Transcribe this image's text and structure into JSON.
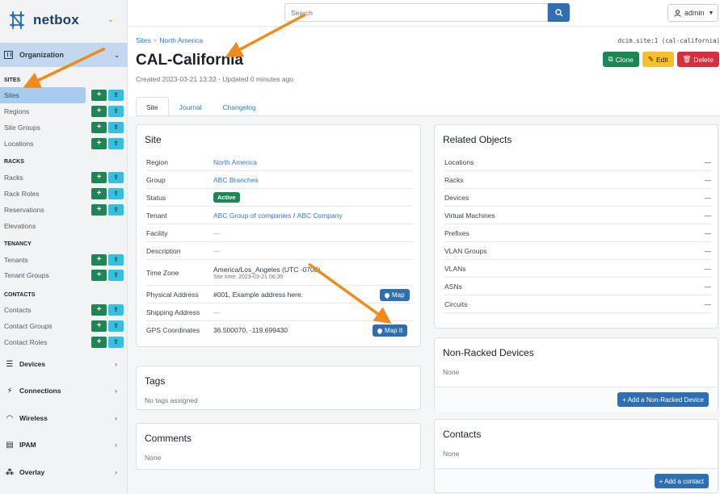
{
  "brand": {
    "name": "netbox"
  },
  "sidebar": {
    "organization": {
      "label": "Organization"
    },
    "sections": {
      "sites": "SITES",
      "racks": "RACKS",
      "tenancy": "TENANCY",
      "contacts": "CONTACTS"
    },
    "items": {
      "sites": "Sites",
      "regions": "Regions",
      "site_groups": "Site Groups",
      "locations": "Locations",
      "racks": "Racks",
      "rack_roles": "Rack Roles",
      "reservations": "Reservations",
      "elevations": "Elevations",
      "tenants": "Tenants",
      "tenant_groups": "Tenant Groups",
      "contacts": "Contacts",
      "contact_groups": "Contact Groups",
      "contact_roles": "Contact Roles"
    },
    "groups": {
      "devices": "Devices",
      "connections": "Connections",
      "wireless": "Wireless",
      "ipam": "IPAM",
      "overlay": "Overlay"
    },
    "add_glyph": "+",
    "import_glyph": "⇪"
  },
  "topbar": {
    "search_placeholder": "Search",
    "user": "admin"
  },
  "page": {
    "breadcrumb": {
      "root": "Sites",
      "parent": "North America"
    },
    "slug": "dcim.site:1 (cal-california)",
    "title": "CAL-California",
    "created": "Created 2023-03-21 13:32 · Updated 0 minutes ago",
    "actions": {
      "clone": "Clone",
      "edit": "Edit",
      "delete": "Delete"
    },
    "tabs": {
      "site": "Site",
      "journal": "Journal",
      "changelog": "Changelog"
    }
  },
  "site_card": {
    "title": "Site",
    "rows": {
      "region": {
        "label": "Region",
        "value": "North America"
      },
      "group": {
        "label": "Group",
        "value": "ABC Branches"
      },
      "status": {
        "label": "Status",
        "value": "Active"
      },
      "tenant": {
        "label": "Tenant",
        "value_group": "ABC Group of companies",
        "sep": " / ",
        "value": "ABC Company"
      },
      "facility": {
        "label": "Facility",
        "value": "—"
      },
      "description": {
        "label": "Description",
        "value": "—"
      },
      "time_zone": {
        "label": "Time Zone",
        "value": "America/Los_Angeles (UTC -0700)",
        "sub": "Site time: 2023-03-21 06:35"
      },
      "physical_address": {
        "label": "Physical Address",
        "value": "#001, Example address here.",
        "button": "Map"
      },
      "shipping_address": {
        "label": "Shipping Address",
        "value": "—"
      },
      "gps": {
        "label": "GPS Coordinates",
        "value": "36.500070, -119.699430",
        "button": "Map It"
      }
    }
  },
  "tags_card": {
    "title": "Tags",
    "empty": "No tags assigned"
  },
  "comments_card": {
    "title": "Comments",
    "empty": "None"
  },
  "related_card": {
    "title": "Related Objects",
    "rows": [
      {
        "label": "Locations",
        "value": "—"
      },
      {
        "label": "Racks",
        "value": "—"
      },
      {
        "label": "Devices",
        "value": "—"
      },
      {
        "label": "Virtual Machines",
        "value": "—"
      },
      {
        "label": "Prefixes",
        "value": "—"
      },
      {
        "label": "VLAN Groups",
        "value": "—"
      },
      {
        "label": "VLANs",
        "value": "—"
      },
      {
        "label": "ASNs",
        "value": "—"
      },
      {
        "label": "Circuits",
        "value": "—"
      }
    ]
  },
  "non_racked_card": {
    "title": "Non-Racked Devices",
    "empty": "None",
    "button": "+ Add a Non-Racked Device"
  },
  "contacts_card": {
    "title": "Contacts",
    "empty": "None",
    "button": "+ Add a contact"
  },
  "colors": {
    "accent": "#2f7bd1",
    "success": "#1a8754",
    "warning": "#f6c02a",
    "danger": "#d32f3f",
    "annotation_arrow": "#f08a1c"
  }
}
